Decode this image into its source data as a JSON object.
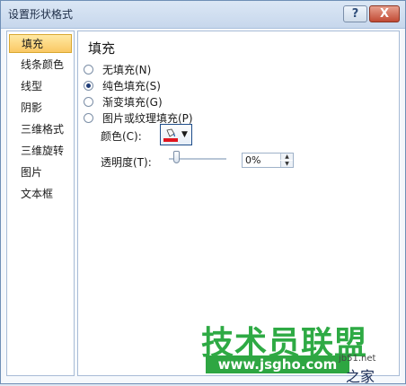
{
  "window": {
    "title": "设置形状格式"
  },
  "titlebar": {
    "help_glyph": "?",
    "close_glyph": "X"
  },
  "sidebar": {
    "items": [
      {
        "label": "填充",
        "selected": true
      },
      {
        "label": "线条颜色"
      },
      {
        "label": "线型"
      },
      {
        "label": "阴影"
      },
      {
        "label": "三维格式"
      },
      {
        "label": "三维旋转"
      },
      {
        "label": "图片"
      },
      {
        "label": "文本框"
      }
    ]
  },
  "content": {
    "heading": "填充",
    "options": [
      {
        "label": "无填充(N)",
        "checked": false
      },
      {
        "label": "纯色填充(S)",
        "checked": true
      },
      {
        "label": "渐变填充(G)",
        "checked": false
      },
      {
        "label": "图片或纹理填充(P)",
        "checked": false
      }
    ],
    "color_label": "颜色(C):",
    "color_accent": "#e0141e",
    "transparency_label": "透明度(T):",
    "transparency_value": "0%",
    "transparency_fraction": 0
  },
  "watermark": {
    "brand": "技术员联盟",
    "url": "www.jsgho.com",
    "jb_small": "jb51.net",
    "jb_big": "之家"
  }
}
